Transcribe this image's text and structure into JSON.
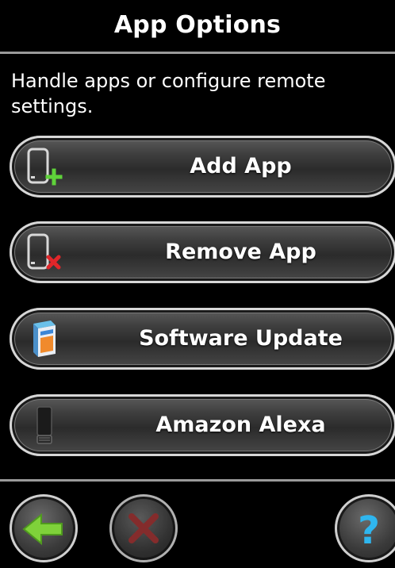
{
  "header": {
    "title": "App Options"
  },
  "description": "Handle apps or configure remote settings.",
  "menu": [
    {
      "label": "Add App",
      "icon": "device-add-icon"
    },
    {
      "label": "Remove App",
      "icon": "device-remove-icon"
    },
    {
      "label": "Software Update",
      "icon": "software-box-icon"
    },
    {
      "label": "Amazon Alexa",
      "icon": "alexa-speaker-icon"
    }
  ],
  "footer": {
    "back_icon": "back-arrow-icon",
    "cancel_icon": "cancel-x-icon",
    "help_icon": "help-question-icon"
  },
  "colors": {
    "accent_green": "#7fd23a",
    "cancel_red": "#b23a3a",
    "help_blue": "#2fb6ef"
  }
}
